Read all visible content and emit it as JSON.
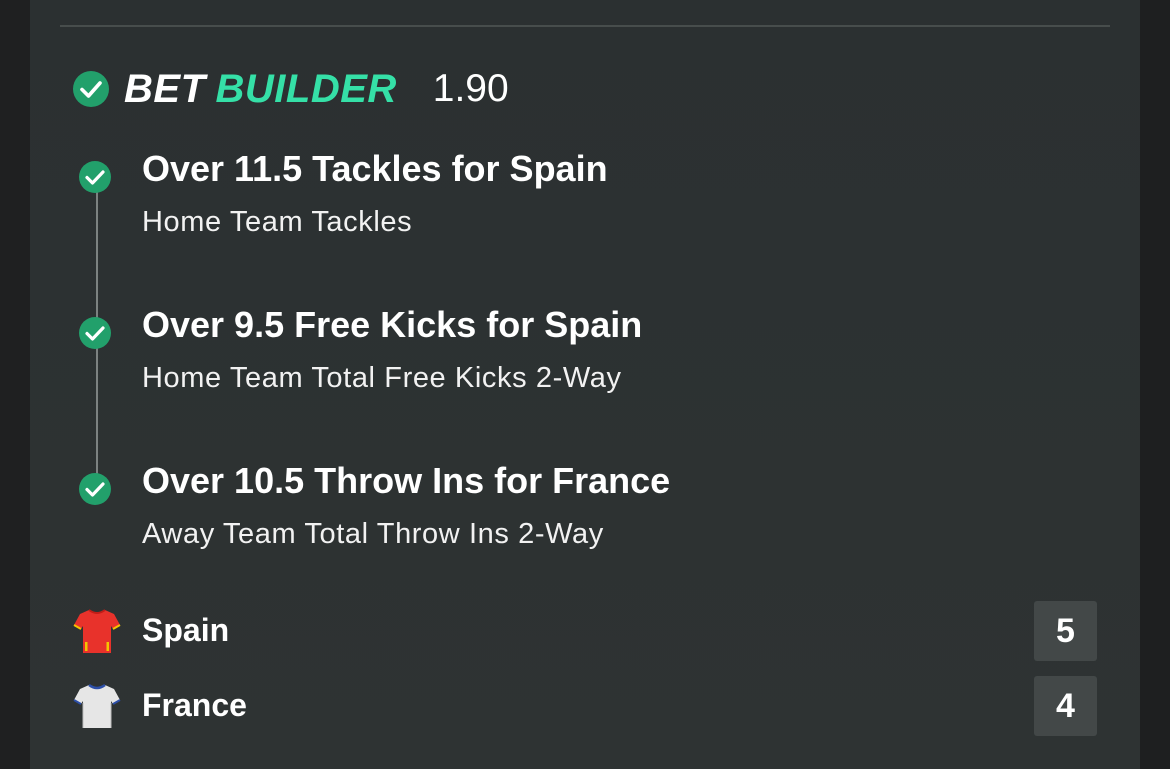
{
  "bet_builder": {
    "title_part1": "BET",
    "title_part2": "BUILDER",
    "odds": "1.90",
    "accent_color": "#35e0a7",
    "check_color": "#22a06b"
  },
  "legs": [
    {
      "title": "Over 11.5 Tackles for Spain",
      "subtitle": "Home Team Tackles",
      "icon": "check-circle-icon"
    },
    {
      "title": "Over 9.5 Free Kicks for Spain",
      "subtitle": "Home Team Total Free Kicks 2-Way",
      "icon": "check-circle-icon"
    },
    {
      "title": "Over 10.5 Throw Ins for France",
      "subtitle": "Away Team Total Throw Ins 2-Way",
      "icon": "check-circle-icon"
    }
  ],
  "teams": [
    {
      "name": "Spain",
      "score": "5",
      "shirt_icon": "red-shirt-icon",
      "shirt_color": "#e8322b"
    },
    {
      "name": "France",
      "score": "4",
      "shirt_icon": "white-shirt-icon",
      "shirt_color": "#e6e6e6"
    }
  ]
}
